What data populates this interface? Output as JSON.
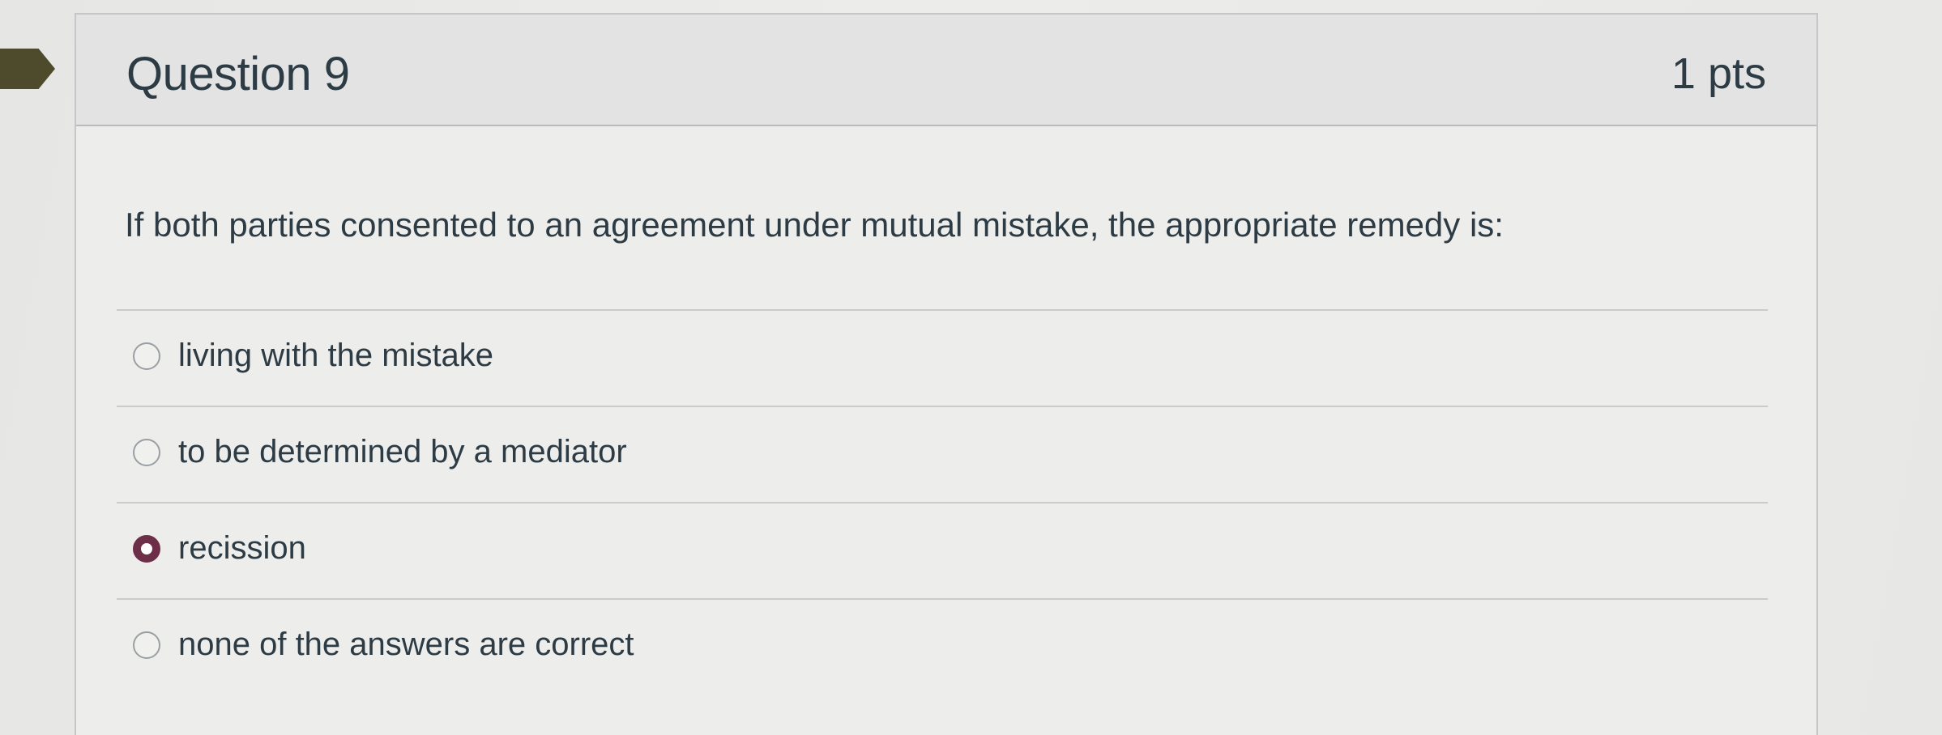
{
  "question": {
    "title": "Question 9",
    "points": "1 pts",
    "text": "If both parties consented to an agreement under mutual mistake, the appropriate remedy is:"
  },
  "answers": [
    {
      "label": "living with the mistake",
      "selected": false
    },
    {
      "label": "to be determined by a mediator",
      "selected": false
    },
    {
      "label": "recission",
      "selected": true
    },
    {
      "label": "none of the answers are correct",
      "selected": false
    }
  ],
  "colors": {
    "accent_selected": "#6d2f47",
    "flag": "#4e4a2c",
    "text": "#2d3b45"
  }
}
